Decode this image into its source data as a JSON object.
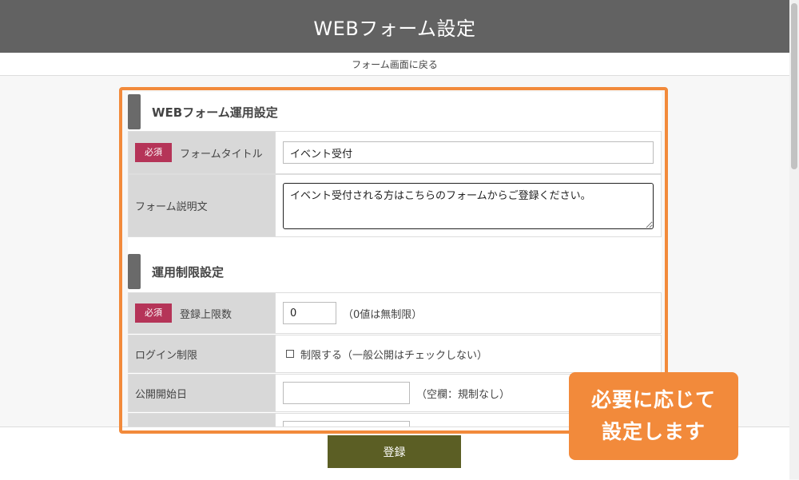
{
  "header": {
    "title": "WEBフォーム設定"
  },
  "nav": {
    "back_link": "フォーム画面に戻る"
  },
  "sections": {
    "operation": {
      "heading": "WEBフォーム運用設定"
    },
    "limits": {
      "heading": "運用制限設定"
    }
  },
  "fields": {
    "form_title": {
      "badge": "必須",
      "label": "フォームタイトル",
      "value": "イベント受付"
    },
    "form_description": {
      "label": "フォーム説明文",
      "value": "イベント受付される方はこちらのフォームからご登録ください。"
    },
    "max_registrations": {
      "badge": "必須",
      "label": "登録上限数",
      "value": "0",
      "hint": "（0値は無制限）"
    },
    "login_restriction": {
      "label": "ログイン制限",
      "checkbox_label": "制限する（一般公開はチェックしない）",
      "checked": false
    },
    "publish_start": {
      "label": "公開開始日",
      "value": "",
      "hint": "（空欄：規制なし）"
    }
  },
  "actions": {
    "submit_label": "登録"
  },
  "callout": {
    "line1": "必要に応じて",
    "line2": "設定します"
  },
  "colors": {
    "header_bg": "#626262",
    "required_badge": "#b53458",
    "submit_button": "#5b5e24",
    "highlight": "#f28a3b"
  }
}
